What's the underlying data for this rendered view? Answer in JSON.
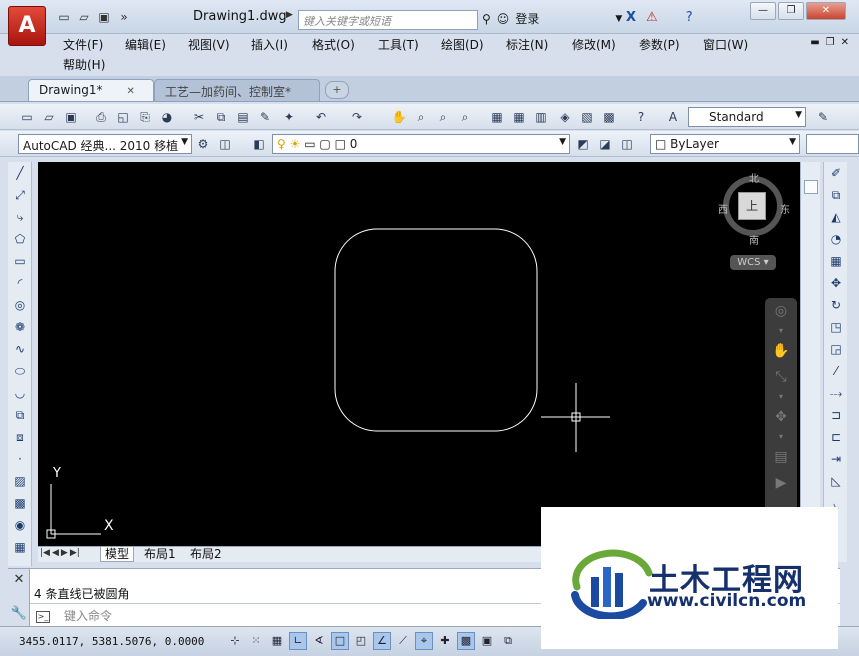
{
  "app": {
    "logo_letter": "A",
    "document_title": "Drawing1.dwg",
    "search_placeholder": "键入关键字或短语",
    "login_label": "登录"
  },
  "window_controls": {
    "minimize": "—",
    "restore": "❐",
    "close": "✕"
  },
  "menu": {
    "items": [
      "文件(F)",
      "编辑(E)",
      "视图(V)",
      "插入(I)",
      "格式(O)",
      "工具(T)",
      "绘图(D)",
      "标注(N)",
      "修改(M)",
      "参数(P)",
      "窗口(W)",
      "帮助(H)"
    ]
  },
  "tabs": {
    "items": [
      {
        "label": "Drawing1*",
        "close": "✕",
        "active": true
      },
      {
        "label": "工艺—加药间、控制室*",
        "close": "✕",
        "active": false
      }
    ],
    "add_label": "+"
  },
  "toolbar1": {
    "text_style": "Standard"
  },
  "toolbar2": {
    "workspace": "AutoCAD 经典... 2010 移植",
    "layer": "0",
    "color": "ByLayer"
  },
  "viewcube": {
    "north": "北",
    "south": "南",
    "east": "东",
    "west": "西",
    "face": "上",
    "wcs": "WCS"
  },
  "ucs": {
    "x": "X",
    "y": "Y"
  },
  "layout_tabs": {
    "items": [
      "模型",
      "布局1",
      "布局2"
    ],
    "selected": "模型"
  },
  "command": {
    "history": "4  条直线已被圆角",
    "placeholder": "键入命令"
  },
  "status": {
    "coordinates": "3455.0117,  5381.5076,  0.0000"
  },
  "watermark": {
    "title": "土木工程网",
    "url": "www.civilcn.com"
  },
  "colors": {
    "canvas": "#000000",
    "brand_red": "#c8281c",
    "watermark_blue": "#15306b"
  }
}
